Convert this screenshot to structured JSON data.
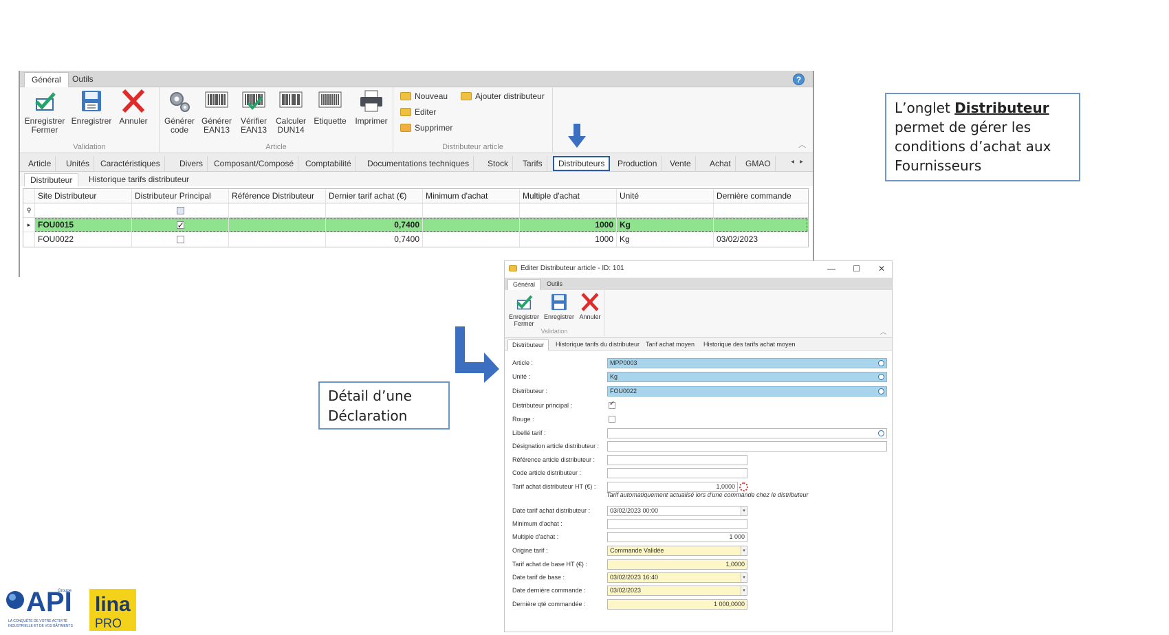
{
  "main": {
    "ribbon_tabs": [
      "Général",
      "Outils"
    ],
    "help": "?",
    "groups": {
      "validation": {
        "label": "Validation",
        "buttons": [
          {
            "label": "Enregistrer\nFermer",
            "l1": "Enregistrer",
            "l2": "Fermer"
          },
          {
            "l1": "Enregistrer",
            "l2": ""
          },
          {
            "l1": "Annuler",
            "l2": ""
          }
        ]
      },
      "article": {
        "label": "Article",
        "buttons": [
          {
            "l1": "Générer",
            "l2": "code"
          },
          {
            "l1": "Générer",
            "l2": "EAN13"
          },
          {
            "l1": "Vérifier",
            "l2": "EAN13"
          },
          {
            "l1": "Calculer",
            "l2": "DUN14"
          },
          {
            "l1": "Etiquette",
            "l2": ""
          },
          {
            "l1": "Imprimer",
            "l2": ""
          }
        ]
      },
      "distributeur_article": {
        "label": "Distributeur article",
        "buttons": [
          "Nouveau",
          "Ajouter distributeur",
          "Editer",
          "Supprimer"
        ]
      }
    },
    "module_tabs": [
      "Article",
      "Unités",
      "Caractéristiques",
      "Divers",
      "Composant/Composé",
      "Comptabilité",
      "Documentations techniques",
      "Stock",
      "Tarifs",
      "Distributeurs",
      "Production",
      "Vente",
      "Achat",
      "GMAO"
    ],
    "sub_tabs": [
      "Distributeur",
      "Historique tarifs distributeur"
    ],
    "grid": {
      "columns": [
        "Site Distributeur",
        "Distributeur Principal",
        "Référence Distributeur",
        "Dernier tarif achat (€)",
        "Minimum d'achat",
        "Multiple d'achat",
        "Unité",
        "Dernière commande"
      ],
      "rows": [
        {
          "site": "FOU0015",
          "principal": true,
          "reference": "",
          "tarif": "0,7400",
          "minimum": "",
          "multiple": "1000",
          "unite": "Kg",
          "derniere": ""
        },
        {
          "site": "FOU0022",
          "principal": false,
          "reference": "",
          "tarif": "0,7400",
          "minimum": "",
          "multiple": "1000",
          "unite": "Kg",
          "derniere": "03/02/2023"
        }
      ]
    }
  },
  "callout1": {
    "prefix": "L’onglet ",
    "bold": "Distributeur",
    "rest": "permet de gérer les conditions d’achat aux Fournisseurs"
  },
  "callout2": {
    "text": "Détail d’une Déclaration"
  },
  "dialog": {
    "title": "Editer Distributeur article - ID: 101",
    "ribbon_tabs": [
      "Général",
      "Outils"
    ],
    "buttons": [
      {
        "l1": "Enregistrer",
        "l2": "Fermer"
      },
      {
        "l1": "Enregistrer",
        "l2": ""
      },
      {
        "l1": "Annuler",
        "l2": ""
      }
    ],
    "group_label": "Validation",
    "sub_tabs": [
      "Distributeur",
      "Historique tarifs du distributeur",
      "Tarif achat moyen",
      "Historique des tarifs achat moyen"
    ],
    "fields": {
      "article": {
        "label": "Article :",
        "value": "MPP0003"
      },
      "unite": {
        "label": "Unité :",
        "value": "Kg"
      },
      "distributeur": {
        "label": "Distributeur :",
        "value": "FOU0022"
      },
      "principal": {
        "label": "Distributeur principal :",
        "checked": true
      },
      "rouge": {
        "label": "Rouge :",
        "checked": false
      },
      "libelle": {
        "label": "Libellé tarif :",
        "value": ""
      },
      "designation": {
        "label": "Désignation article distributeur :",
        "value": ""
      },
      "reference": {
        "label": "Référence article distributeur :",
        "value": ""
      },
      "code": {
        "label": "Code article distributeur :",
        "value": ""
      },
      "tarif_ht": {
        "label": "Tarif achat distributeur HT (€) :",
        "value": "1,0000"
      },
      "hint": "Tarif automatiquement actualisé lors d'une commande chez le distributeur",
      "date_tarif": {
        "label": "Date tarif achat distributeur :",
        "value": "03/02/2023 00:00"
      },
      "minimum": {
        "label": "Minimum d'achat :",
        "value": ""
      },
      "multiple": {
        "label": "Multiple d'achat :",
        "value": "1 000"
      },
      "origine": {
        "label": "Origine tarif :",
        "value": "Commande Validée"
      },
      "tarif_base": {
        "label": "Tarif achat de base HT (€) :",
        "value": "1,0000"
      },
      "date_base": {
        "label": "Date tarif de base :",
        "value": "03/02/2023 16:40"
      },
      "date_commande": {
        "label": "Date dernière commande :",
        "value": "03/02/2023"
      },
      "qte": {
        "label": "Dernière qté commandée :",
        "value": "1 000,0000"
      }
    }
  },
  "logo": {
    "api": "API",
    "groupe": "Groupe",
    "tagline1": "LA CONQUÊTE DE VOTRE ACTIVITÉ",
    "tagline2": "INDUSTRIELLE ET DE VOS BÂTIMENTS",
    "lina": "lina",
    "pro": "PRO"
  },
  "colors": {
    "selected_row": "#8fe38f",
    "field_blue": "#a8d4ec",
    "field_yellow": "#fdf6c6",
    "accent_blue": "#2e5b9e",
    "callout_border": "#6b96c8",
    "arrow_blue": "#3c6fc0"
  }
}
